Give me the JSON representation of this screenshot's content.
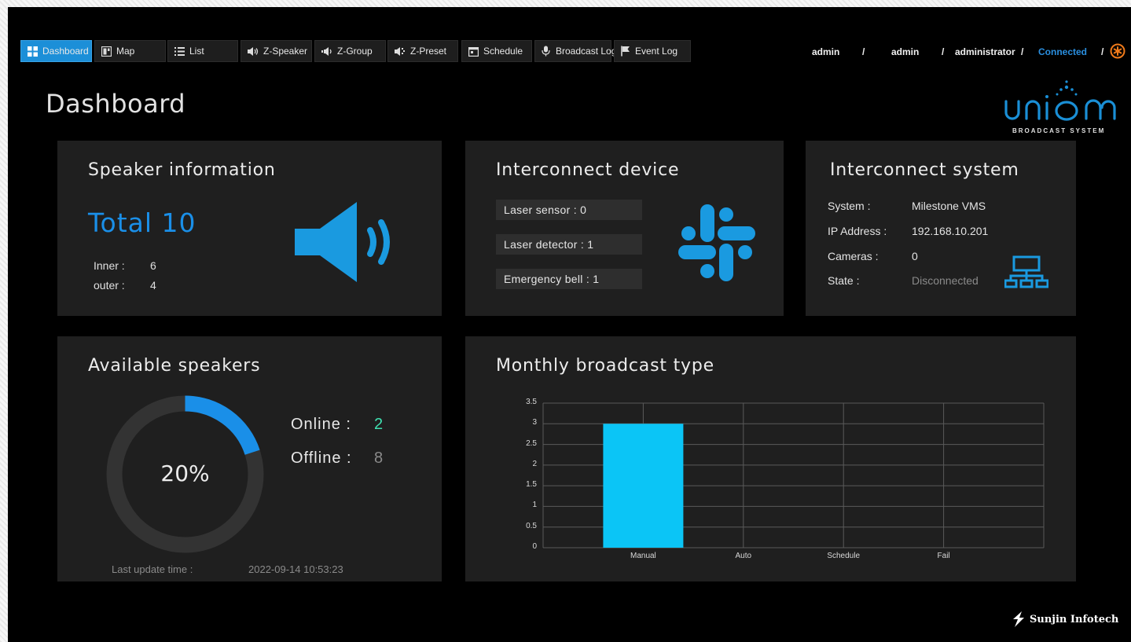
{
  "nav": {
    "items": [
      {
        "label": "Dashboard",
        "icon": "dashboard-grid-icon",
        "active": true
      },
      {
        "label": "Map",
        "icon": "map-icon",
        "active": false
      },
      {
        "label": "List",
        "icon": "list-icon",
        "active": false
      },
      {
        "label": "Z-Speaker",
        "icon": "speaker-icon",
        "active": false
      },
      {
        "label": "Z-Group",
        "icon": "speaker-group-icon",
        "active": false
      },
      {
        "label": "Z-Preset",
        "icon": "preset-icon",
        "active": false
      },
      {
        "label": "Schedule",
        "icon": "calendar-icon",
        "active": false
      },
      {
        "label": "Broadcast Log",
        "icon": "microphone-icon",
        "active": false
      },
      {
        "label": "Event Log",
        "icon": "flag-icon",
        "active": false
      }
    ]
  },
  "user": {
    "id": "admin",
    "name": "admin",
    "role": "administrator",
    "status": "Connected",
    "separator": "/",
    "status_color": "#2a8fe0"
  },
  "page": {
    "title": "Dashboard"
  },
  "logo": {
    "text": "BROADCAST SYSTEM",
    "brand_name": "union",
    "color": "#1a8fd6"
  },
  "speaker_info": {
    "title": "Speaker information",
    "total": "Total 10",
    "inner_label": "Inner :",
    "inner_value": "6",
    "outer_label": "outer :",
    "outer_value": "4"
  },
  "interconnect_device": {
    "title": "Interconnect device",
    "rows": [
      "Laser sensor :   0",
      "Laser detector :  1",
      "Emergency bell : 1"
    ]
  },
  "interconnect_system": {
    "title": "Interconnect system",
    "system_label": "System :",
    "system_value": "Milestone VMS",
    "ip_label": "IP Address :",
    "ip_value": "192.168.10.201",
    "cameras_label": "Cameras :",
    "cameras_value": "0",
    "state_label": "State :",
    "state_value": "Disconnected"
  },
  "available_speakers": {
    "title": "Available speakers",
    "percent_label": "20%",
    "percent": 0.2,
    "online_label": "Online :",
    "online_value": "2",
    "offline_label": "Offline :",
    "offline_value": "8",
    "last_update_label": "Last update time :",
    "last_update_value": "2022-09-14 10:53:23",
    "online_color": "#3fe0b0",
    "arc_color": "#1a8fe8"
  },
  "monthly": {
    "title": "Monthly broadcast type"
  },
  "chart_data": {
    "type": "bar",
    "categories": [
      "Manual",
      "Auto",
      "Schedule",
      "Fail"
    ],
    "values": [
      3,
      0,
      0,
      0
    ],
    "ylim": [
      0,
      3.5
    ],
    "yticks": [
      "0",
      "0.5",
      "1",
      "1.5",
      "2",
      "2.5",
      "3",
      "3.5"
    ],
    "grid": true,
    "bar_color": "#0bc5f6"
  },
  "footer": {
    "company": "Sunjin Infotech"
  }
}
